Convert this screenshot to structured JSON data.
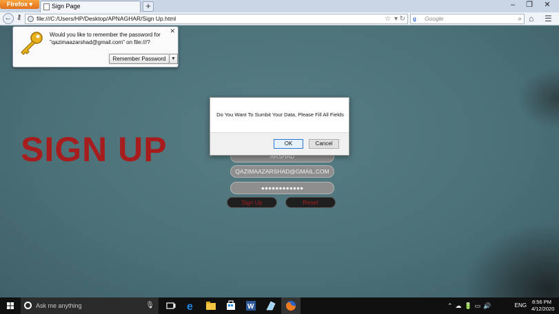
{
  "browser": {
    "app_button_label": "Firefox",
    "tab_title": "Sign Page",
    "new_tab_label": "+",
    "url": "file:///C:/Users/HP/Desktop/APNAGHAR/Sign Up.html",
    "search_placeholder": "Google",
    "window_controls": {
      "minimize": "–",
      "restore": "❐",
      "close": "✕"
    }
  },
  "password_prompt": {
    "message": "Would you like to remember the password for\n\"qazimaazarshad@gmail.com\" on file:///?",
    "remember_button": "Remember Password",
    "dropdown_glyph": "▼",
    "close_glyph": "✕"
  },
  "page": {
    "title": "SIGN UP",
    "fields": [
      "ARSHAD",
      "QAZIMAAZARSHAD@GMAIL.COM",
      "●●●●●●●●●●●●"
    ],
    "sign_up_button": "Sign Up",
    "reset_button": "Reset",
    "colors": {
      "accent": "#a71d1d",
      "background": "#4b7078"
    }
  },
  "alert": {
    "message": "Do You Want To Sumbit Your Data, Please Fill All Fields",
    "ok_label": "OK",
    "cancel_label": "Cancel"
  },
  "taskbar": {
    "search_placeholder": "Ask me anything",
    "language": "ENG",
    "time": "8:56 PM",
    "date": "4/12/2020",
    "apps": [
      "task-view-icon",
      "edge-icon",
      "file-explorer-icon",
      "store-icon",
      "word-icon",
      "notes-icon",
      "firefox-icon"
    ]
  }
}
